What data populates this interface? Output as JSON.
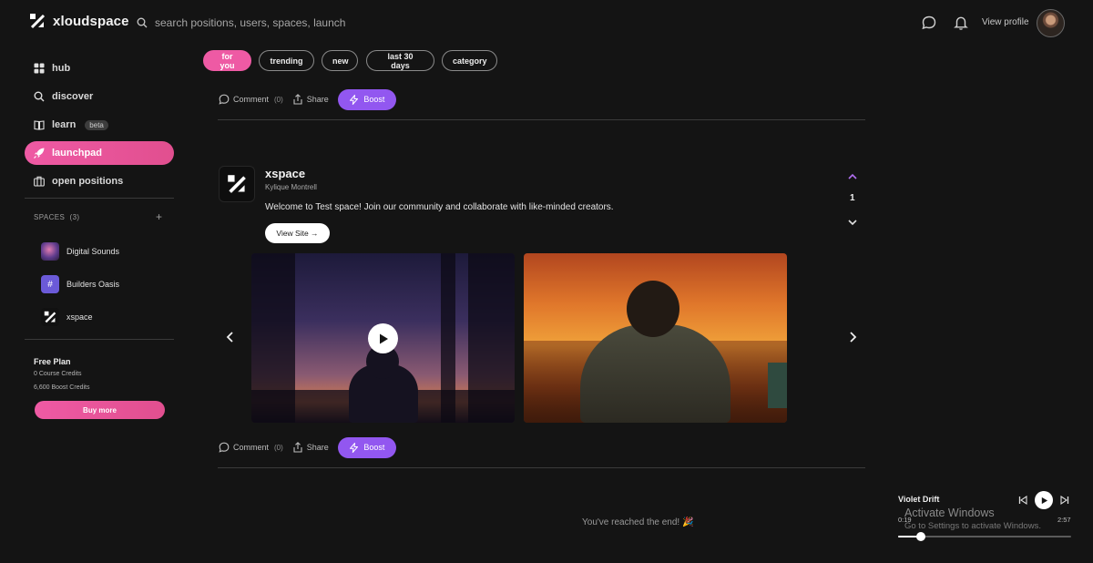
{
  "app": {
    "name": "xloudspace"
  },
  "search": {
    "placeholder": "search positions, users, spaces, launches, posts"
  },
  "header": {
    "view_profile": "View profile"
  },
  "sidebar": {
    "nav": [
      {
        "label": "hub",
        "icon": "grid-icon"
      },
      {
        "label": "discover",
        "icon": "search-icon"
      },
      {
        "label": "learn",
        "icon": "book-icon",
        "badge": "beta"
      },
      {
        "label": "launchpad",
        "icon": "rocket-icon",
        "active": true
      },
      {
        "label": "open positions",
        "icon": "briefcase-icon"
      }
    ],
    "spaces_label": "SPACES",
    "spaces_count": "(3)",
    "spaces": [
      {
        "label": "Digital Sounds"
      },
      {
        "label": "Builders Oasis",
        "glyph": "#"
      },
      {
        "label": "xspace"
      }
    ],
    "plan": {
      "title": "Free Plan",
      "course_credits": "0 Course Credits",
      "boost_credits": "6,600 Boost Credits",
      "buy_label": "Buy more"
    }
  },
  "filters": [
    "for you",
    "trending",
    "new",
    "last 30 days",
    "category"
  ],
  "actions": {
    "comment": "Comment",
    "comment_count": "(0)",
    "share": "Share",
    "boost": "Boost"
  },
  "post": {
    "title": "xspace",
    "author": "Kylique Montrell",
    "text": "Welcome to Test space! Join our community and collaborate with like-minded creators.",
    "view_site": "View Site →",
    "votes": "1"
  },
  "feed": {
    "end_text": "You've reached the end! 🎉"
  },
  "player": {
    "title": "Violet Drift",
    "elapsed": "0:19",
    "duration": "2:57",
    "progress": 0.13
  },
  "os_watermark": {
    "line1": "Activate Windows",
    "line2": "Go to Settings to activate Windows."
  },
  "colors": {
    "accent_pink": "#ee5aa4",
    "accent_purple": "#9257f0",
    "background": "#141414"
  }
}
